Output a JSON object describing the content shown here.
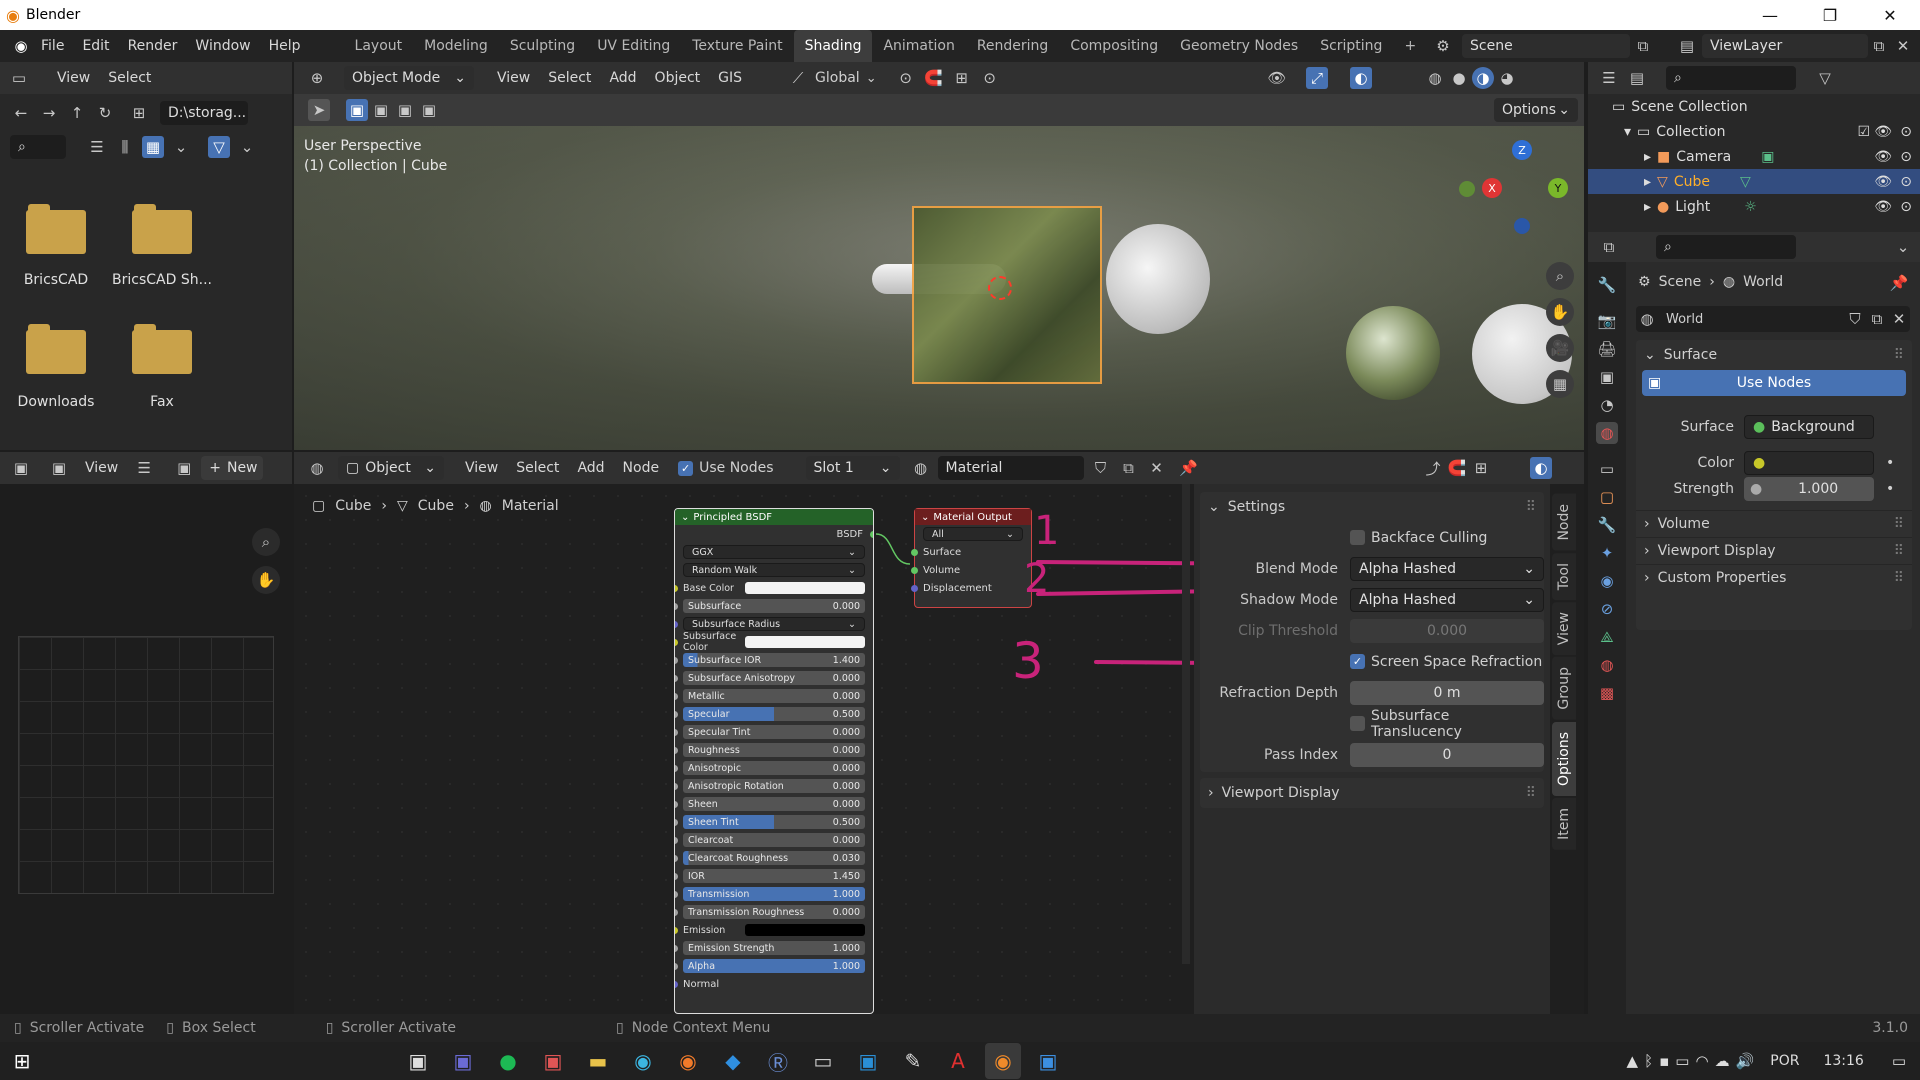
{
  "window": {
    "title": "Blender",
    "minimize": "—",
    "maximize": "❐",
    "close": "✕"
  },
  "menu": [
    "File",
    "Edit",
    "Render",
    "Window",
    "Help"
  ],
  "workspaces": [
    "Layout",
    "Modeling",
    "Sculpting",
    "UV Editing",
    "Texture Paint",
    "Shading",
    "Animation",
    "Rendering",
    "Compositing",
    "Geometry Nodes",
    "Scripting"
  ],
  "active_workspace": "Shading",
  "scene": "Scene",
  "view_layer": "ViewLayer",
  "filebrowser": {
    "view": "View",
    "select": "Select",
    "path": "D:\\storag...",
    "items": [
      "BricsCAD",
      "BricsCAD Sh...",
      "Downloads",
      "Fax"
    ]
  },
  "viewport": {
    "mode": "Object Mode",
    "menus": [
      "View",
      "Select",
      "Add",
      "Object",
      "GIS"
    ],
    "orientation": "Global",
    "options": "Options",
    "perspective": "User Perspective",
    "collection": "(1) Collection | Cube"
  },
  "image_editor": {
    "view": "View",
    "new": "New"
  },
  "node_editor": {
    "type": "Object",
    "menus": [
      "View",
      "Select",
      "Add",
      "Node"
    ],
    "use_nodes": "Use Nodes",
    "slot": "Slot 1",
    "material": "Material",
    "breadcrumb": [
      "Cube",
      "Cube",
      "Material"
    ]
  },
  "bsdf": {
    "title": "Principled BSDF",
    "output": "BSDF",
    "dist": "GGX",
    "sss": "Random Walk",
    "rows": [
      {
        "label": "Base Color",
        "type": "color",
        "sock": "y"
      },
      {
        "label": "Subsurface",
        "value": "0.000",
        "f": 0
      },
      {
        "label": "Subsurface Radius",
        "type": "drop",
        "sock": "b"
      },
      {
        "label": "Subsurface Color",
        "type": "color",
        "sock": "y"
      },
      {
        "label": "Subsurface IOR",
        "value": "1.400",
        "f": 8
      },
      {
        "label": "Subsurface Anisotropy",
        "value": "0.000",
        "f": 0
      },
      {
        "label": "Metallic",
        "value": "0.000",
        "f": 0
      },
      {
        "label": "Specular",
        "value": "0.500",
        "f": 50
      },
      {
        "label": "Specular Tint",
        "value": "0.000",
        "f": 0
      },
      {
        "label": "Roughness",
        "value": "0.000",
        "f": 0
      },
      {
        "label": "Anisotropic",
        "value": "0.000",
        "f": 0
      },
      {
        "label": "Anisotropic Rotation",
        "value": "0.000",
        "f": 0
      },
      {
        "label": "Sheen",
        "value": "0.000",
        "f": 0
      },
      {
        "label": "Sheen Tint",
        "value": "0.500",
        "f": 50
      },
      {
        "label": "Clearcoat",
        "value": "0.000",
        "f": 0
      },
      {
        "label": "Clearcoat Roughness",
        "value": "0.030",
        "f": 3
      },
      {
        "label": "IOR",
        "value": "1.450",
        "f": 0
      },
      {
        "label": "Transmission",
        "value": "1.000",
        "f": 100
      },
      {
        "label": "Transmission Roughness",
        "value": "0.000",
        "f": 0
      },
      {
        "label": "Emission",
        "type": "black",
        "sock": "y"
      },
      {
        "label": "Emission Strength",
        "value": "1.000",
        "f": 0
      },
      {
        "label": "Alpha",
        "value": "1.000",
        "f": 100
      },
      {
        "label": "Normal",
        "type": "plain",
        "sock": "b"
      }
    ]
  },
  "matout": {
    "title": "Material Output",
    "target": "All",
    "inputs": [
      "Surface",
      "Volume",
      "Displacement"
    ]
  },
  "annotations": [
    "1",
    "2",
    "3"
  ],
  "settings": {
    "title": "Settings",
    "backface": "Backface Culling",
    "blend_label": "Blend Mode",
    "blend": "Alpha Hashed",
    "shadow_label": "Shadow Mode",
    "shadow": "Alpha Hashed",
    "clip_label": "Clip Threshold",
    "clip": "0.000",
    "ssr": "Screen Space Refraction",
    "refr_label": "Refraction Depth",
    "refr": "0 m",
    "sst": "Subsurface Translucency",
    "pass_label": "Pass Index",
    "pass": "0",
    "viewport_display": "Viewport Display"
  },
  "side_tabs": [
    "Node",
    "Tool",
    "View",
    "Group",
    "Options",
    "Item"
  ],
  "outliner": {
    "root": "Scene Collection",
    "collection": "Collection",
    "items": [
      "Camera",
      "Cube",
      "Light"
    ]
  },
  "properties": {
    "breadcrumb_scene": "Scene",
    "breadcrumb_world": "World",
    "world": "World",
    "surface": "Surface",
    "use_nodes": "Use Nodes",
    "surface_label": "Surface",
    "surface_val": "Background",
    "color_label": "Color",
    "strength_label": "Strength",
    "strength": "1.000",
    "sections": [
      "Volume",
      "Viewport Display",
      "Custom Properties"
    ]
  },
  "status": {
    "a": "Scroller Activate",
    "b": "Box Select",
    "c": "Scroller Activate",
    "d": "Node Context Menu",
    "version": "3.1.0"
  },
  "taskbar": {
    "lang": "POR",
    "time": "13:16"
  }
}
